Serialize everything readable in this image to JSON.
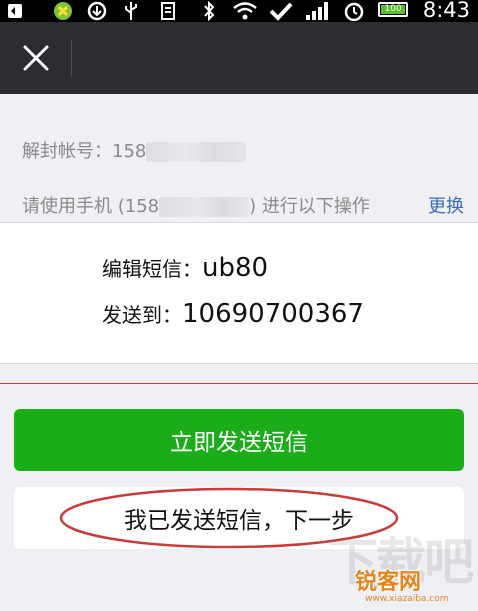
{
  "status_bar": {
    "time": "8:43",
    "battery": "100",
    "icons": [
      "usb-debug-icon",
      "app-notification-icon",
      "download-icon",
      "usb-icon",
      "file-icon",
      "bluetooth-icon",
      "wifi-icon",
      "check-icon",
      "signal-icon",
      "alarm-icon",
      "battery-icon"
    ]
  },
  "title_bar": {
    "close_icon": "close-icon"
  },
  "account": {
    "label": "解封帐号：",
    "number_prefix": "158"
  },
  "instruction": {
    "prefix": "请使用手机 (",
    "number_prefix": "158",
    "suffix": ") 进行以下操作",
    "change_label": "更换"
  },
  "sms": {
    "edit_label": "编辑短信：",
    "edit_value": "ub80",
    "send_to_label": "发送到：",
    "send_to_value": "10690700367"
  },
  "buttons": {
    "send_sms": "立即发送短信",
    "next_step": "我已发送短信，下一步"
  },
  "watermark": {
    "brand": "锐客网",
    "big": "下载吧",
    "url": "www.xiazaiba.com"
  },
  "colors": {
    "accent_green": "#1aad19",
    "link_blue": "#3a6eb6",
    "title_bar": "#2c2d31",
    "annotation_red": "#c93a3a"
  }
}
